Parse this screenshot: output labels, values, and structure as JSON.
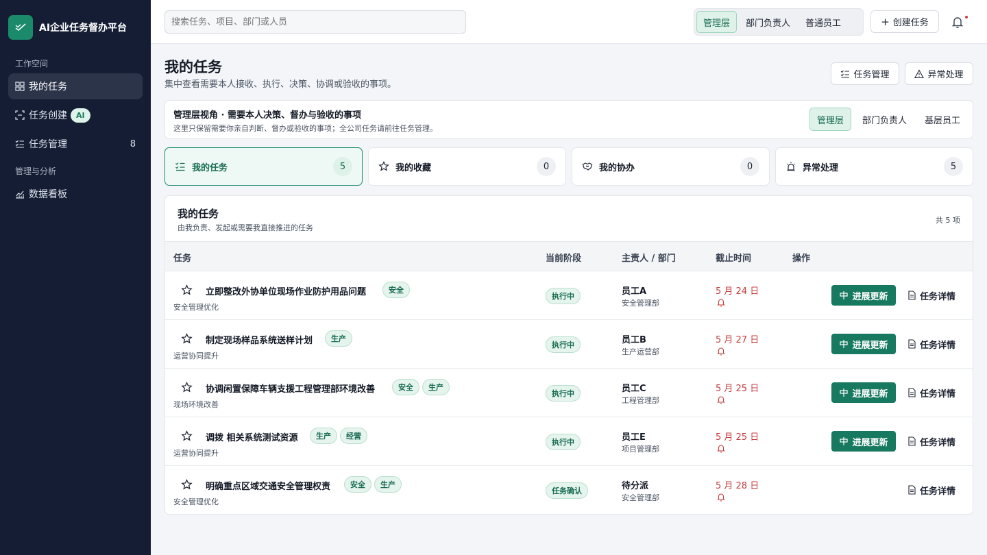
{
  "brand": {
    "name": "AI企业任务督办平台"
  },
  "sidebar": {
    "section_workspace": "工作空间",
    "section_analysis": "管理与分析",
    "items": [
      {
        "label": "我的任务",
        "icon": "grid-icon",
        "active": true
      },
      {
        "label": "任务创建",
        "icon": "scan-icon",
        "badge": "AI"
      },
      {
        "label": "任务管理",
        "icon": "checklist-icon",
        "count": "8"
      },
      {
        "label": "数据看板",
        "icon": "chart-icon"
      }
    ]
  },
  "topbar": {
    "search_placeholder": "搜索任务、项目、部门或人员",
    "roles": [
      "管理层",
      "部门负责人",
      "普通员工"
    ],
    "active_role": "管理层",
    "create_label": "创建任务"
  },
  "page": {
    "title": "我的任务",
    "subtitle": "集中查看需要本人接收、执行、决策、协调或验收的事项。",
    "btn_manage": "任务管理",
    "btn_exception": "异常处理"
  },
  "role_card": {
    "title": "管理层视角 · 需要本人决策、督办与验收的事项",
    "subtitle": "这里只保留需要你亲自判断、督办或验收的事项；全公司任务请前往任务管理。",
    "tabs": [
      "管理层",
      "部门负责人",
      "基层员工"
    ]
  },
  "stats": [
    {
      "label": "我的任务",
      "count": "5",
      "icon": "checklist-icon",
      "active": true
    },
    {
      "label": "我的收藏",
      "count": "0",
      "icon": "star-icon"
    },
    {
      "label": "我的协办",
      "count": "0",
      "icon": "handshake-icon"
    },
    {
      "label": "异常处理",
      "count": "5",
      "icon": "alarm-icon"
    }
  ],
  "list": {
    "title": "我的任务",
    "subtitle": "由我负责、发起或需要我直接推进的任务",
    "total": "共 5 项",
    "columns": [
      "任务",
      "当前阶段",
      "主责人 / 部门",
      "截止时间",
      "操作"
    ],
    "update_label": "进展更新",
    "detail_label": "任务详情",
    "rows": [
      {
        "title": "立即整改外协单位现场作业防护用品问题",
        "tags": [
          "安全"
        ],
        "category": "安全管理优化",
        "stage": "执行中",
        "owner": "员工A",
        "dept": "安全管理部",
        "due": "5 月 24 日",
        "can_update": true
      },
      {
        "title": "制定现场样品系统送样计划",
        "tags": [
          "生产"
        ],
        "category": "运营协同提升",
        "stage": "执行中",
        "owner": "员工B",
        "dept": "生产运营部",
        "due": "5 月 27 日",
        "can_update": true
      },
      {
        "title": "协调闲置保障车辆支援工程管理部环境改善",
        "tags": [
          "安全",
          "生产"
        ],
        "category": "现场环境改善",
        "stage": "执行中",
        "owner": "员工C",
        "dept": "工程管理部",
        "due": "5 月 25 日",
        "can_update": true
      },
      {
        "title": "调拨 相关系统测试资源",
        "tags": [
          "生产",
          "经营"
        ],
        "category": "运营协同提升",
        "stage": "执行中",
        "owner": "员工E",
        "dept": "项目管理部",
        "due": "5 月 25 日",
        "can_update": true
      },
      {
        "title": "明确重点区域交通安全管理权责",
        "tags": [
          "安全",
          "生产"
        ],
        "category": "安全管理优化",
        "stage": "任务确认",
        "owner": "待分派",
        "dept": "安全管理部",
        "due": "5 月 28 日",
        "can_update": false
      }
    ]
  },
  "colors": {
    "accent": "#1b8a6b",
    "sidebar": "#141d33",
    "danger": "#c43c3c"
  }
}
